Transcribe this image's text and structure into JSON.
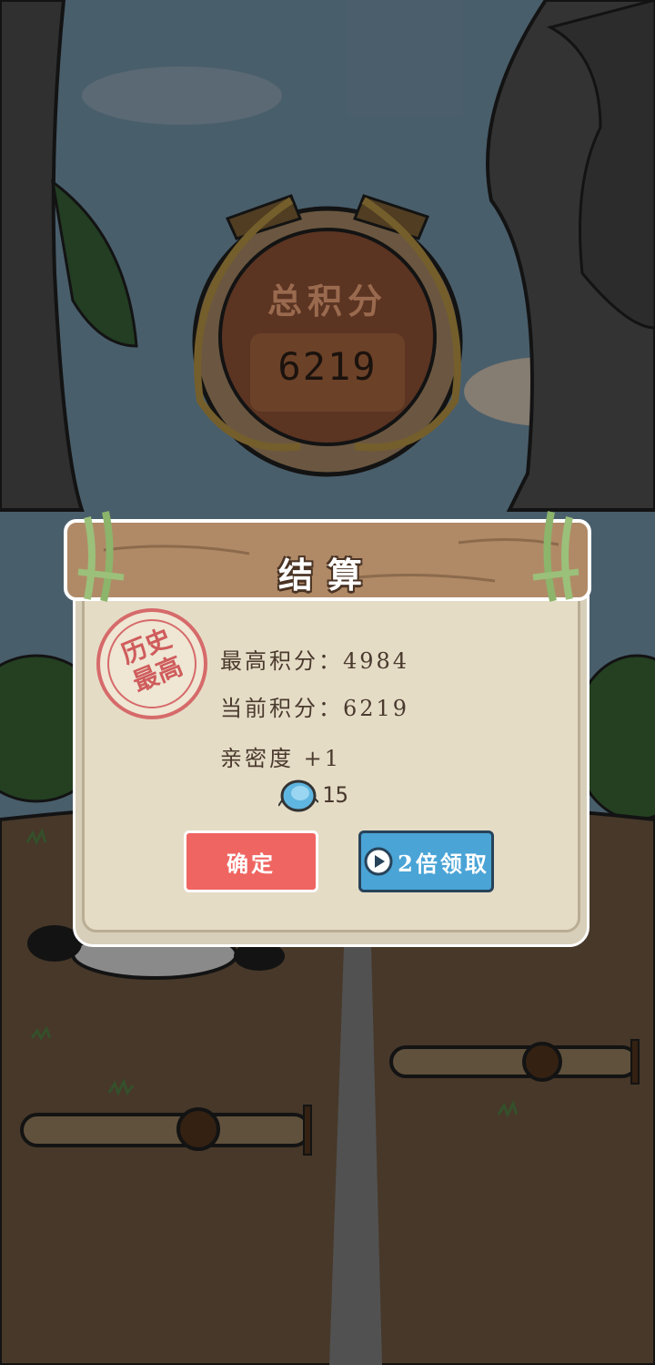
{
  "score_sign": {
    "title": "总积分",
    "value": "6219"
  },
  "dialog": {
    "title": "结算",
    "stamp_line1": "历史",
    "stamp_line2": "最高",
    "best_score_line": "最高积分：4984",
    "current_score_line": "当前积分：6219",
    "intimacy_line": "亲密度 +1",
    "gem_count": "15",
    "confirm_label": "确定",
    "double_label": "2倍领取"
  },
  "icons": {
    "gem": "blue-gem-icon",
    "play": "play-circle-icon",
    "stamp": "record-stamp-icon"
  },
  "colors": {
    "confirm_button": "#ef6561",
    "double_button": "#4aa4d6",
    "stamp": "#d66a6a",
    "dialog_bg": "#e5dcc6",
    "header_wood": "#b08a67"
  }
}
